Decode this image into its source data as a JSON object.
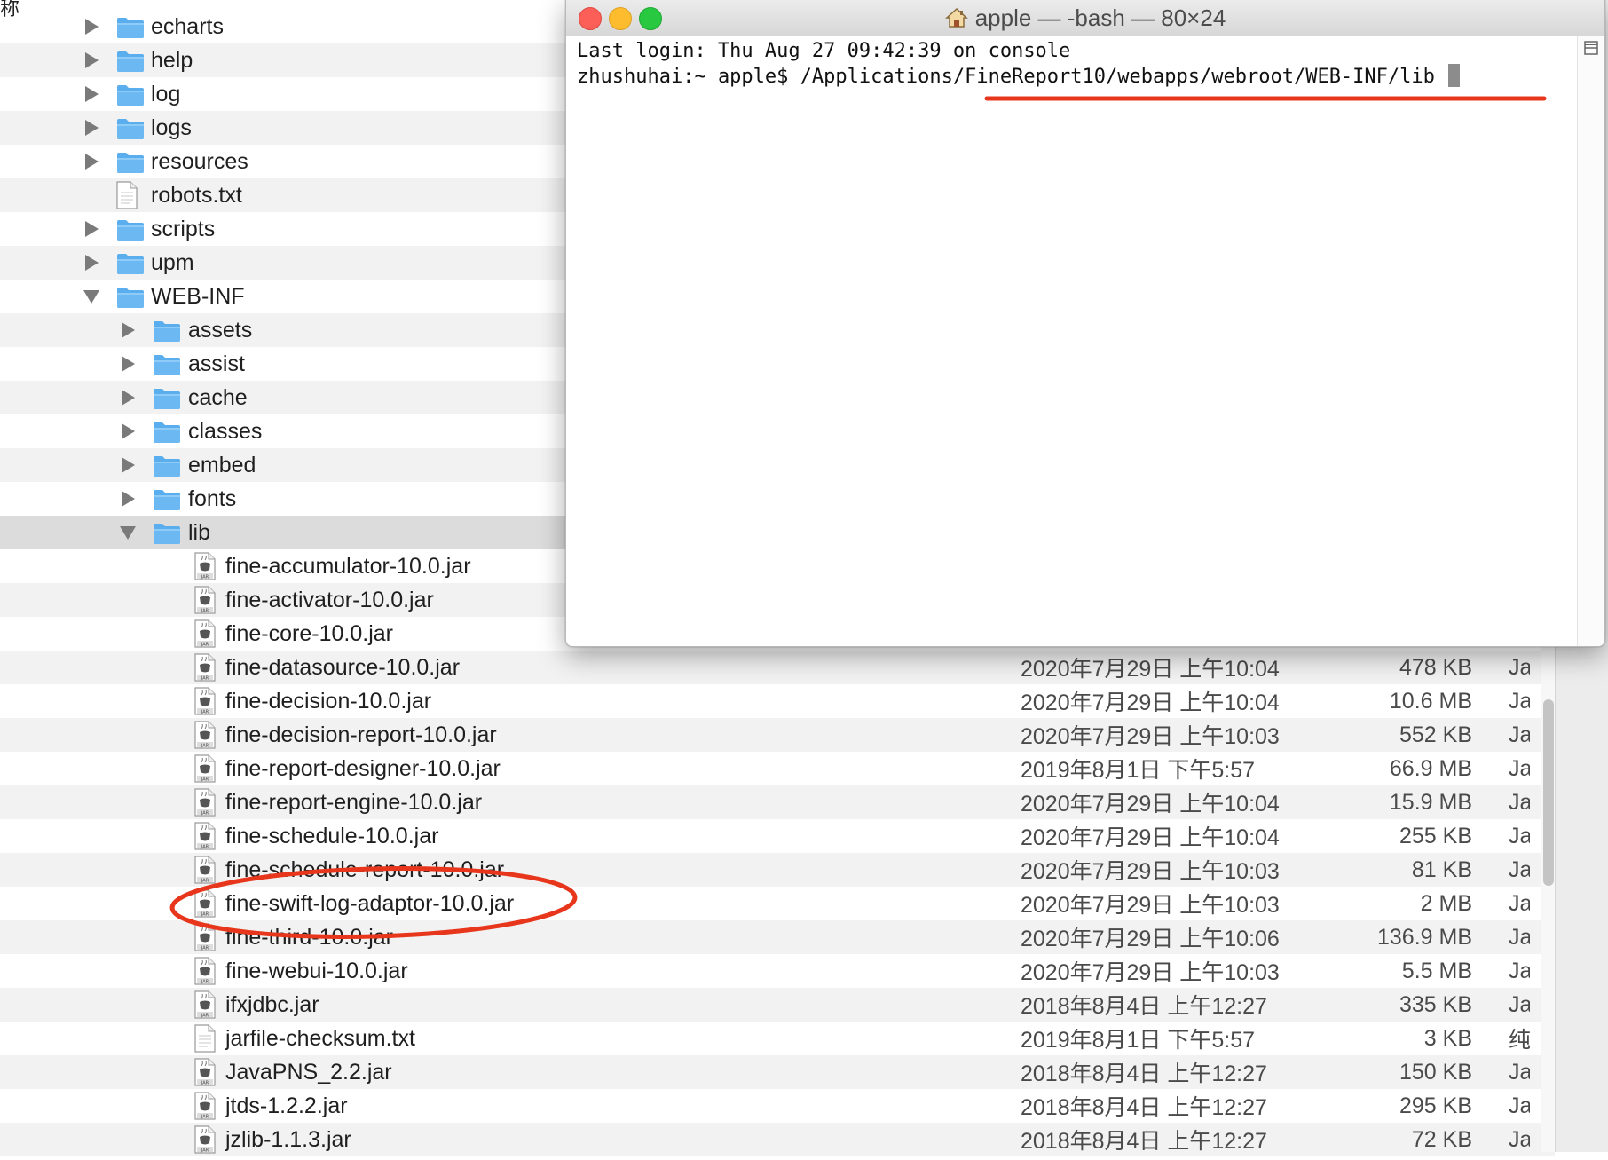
{
  "finder": {
    "top_label": "称",
    "rows": [
      {
        "name": "echarts",
        "type": "folder",
        "depth": 0,
        "state": "collapsed",
        "date": "",
        "size": "",
        "kind": ""
      },
      {
        "name": "help",
        "type": "folder",
        "depth": 0,
        "state": "collapsed",
        "date": "",
        "size": "",
        "kind": ""
      },
      {
        "name": "log",
        "type": "folder",
        "depth": 0,
        "state": "collapsed",
        "date": "",
        "size": "",
        "kind": ""
      },
      {
        "name": "logs",
        "type": "folder",
        "depth": 0,
        "state": "collapsed",
        "date": "",
        "size": "",
        "kind": ""
      },
      {
        "name": "resources",
        "type": "folder",
        "depth": 0,
        "state": "collapsed",
        "date": "",
        "size": "",
        "kind": ""
      },
      {
        "name": "robots.txt",
        "type": "txt",
        "depth": 0,
        "state": "none",
        "date": "",
        "size": "",
        "kind": ""
      },
      {
        "name": "scripts",
        "type": "folder",
        "depth": 0,
        "state": "collapsed",
        "date": "",
        "size": "",
        "kind": ""
      },
      {
        "name": "upm",
        "type": "folder",
        "depth": 0,
        "state": "collapsed",
        "date": "",
        "size": "",
        "kind": ""
      },
      {
        "name": "WEB-INF",
        "type": "folder",
        "depth": 0,
        "state": "expanded",
        "date": "",
        "size": "",
        "kind": ""
      },
      {
        "name": "assets",
        "type": "folder",
        "depth": 1,
        "state": "collapsed",
        "date": "",
        "size": "",
        "kind": ""
      },
      {
        "name": "assist",
        "type": "folder",
        "depth": 1,
        "state": "collapsed",
        "date": "",
        "size": "",
        "kind": ""
      },
      {
        "name": "cache",
        "type": "folder",
        "depth": 1,
        "state": "collapsed",
        "date": "",
        "size": "",
        "kind": ""
      },
      {
        "name": "classes",
        "type": "folder",
        "depth": 1,
        "state": "collapsed",
        "date": "",
        "size": "",
        "kind": ""
      },
      {
        "name": "embed",
        "type": "folder",
        "depth": 1,
        "state": "collapsed",
        "date": "",
        "size": "",
        "kind": ""
      },
      {
        "name": "fonts",
        "type": "folder",
        "depth": 1,
        "state": "collapsed",
        "date": "",
        "size": "",
        "kind": ""
      },
      {
        "name": "lib",
        "type": "folder",
        "depth": 1,
        "state": "expanded",
        "selected": true,
        "date": "",
        "size": "",
        "kind": ""
      },
      {
        "name": "fine-accumulator-10.0.jar",
        "type": "jar",
        "depth": 2,
        "state": "none",
        "date": "",
        "size": "",
        "kind": ""
      },
      {
        "name": "fine-activator-10.0.jar",
        "type": "jar",
        "depth": 2,
        "state": "none",
        "date": "",
        "size": "",
        "kind": ""
      },
      {
        "name": "fine-core-10.0.jar",
        "type": "jar",
        "depth": 2,
        "state": "none",
        "date": "",
        "size": "",
        "kind": ""
      },
      {
        "name": "fine-datasource-10.0.jar",
        "type": "jar",
        "depth": 2,
        "state": "none",
        "date": "2020年7月29日 上午10:04",
        "size": "478 KB",
        "kind": "Ja"
      },
      {
        "name": "fine-decision-10.0.jar",
        "type": "jar",
        "depth": 2,
        "state": "none",
        "date": "2020年7月29日 上午10:04",
        "size": "10.6 MB",
        "kind": "Ja"
      },
      {
        "name": "fine-decision-report-10.0.jar",
        "type": "jar",
        "depth": 2,
        "state": "none",
        "date": "2020年7月29日 上午10:03",
        "size": "552 KB",
        "kind": "Ja"
      },
      {
        "name": "fine-report-designer-10.0.jar",
        "type": "jar",
        "depth": 2,
        "state": "none",
        "date": "2019年8月1日 下午5:57",
        "size": "66.9 MB",
        "kind": "Ja"
      },
      {
        "name": "fine-report-engine-10.0.jar",
        "type": "jar",
        "depth": 2,
        "state": "none",
        "date": "2020年7月29日 上午10:04",
        "size": "15.9 MB",
        "kind": "Ja"
      },
      {
        "name": "fine-schedule-10.0.jar",
        "type": "jar",
        "depth": 2,
        "state": "none",
        "date": "2020年7月29日 上午10:04",
        "size": "255 KB",
        "kind": "Ja"
      },
      {
        "name": "fine-schedule-report-10.0.jar",
        "type": "jar",
        "depth": 2,
        "state": "none",
        "date": "2020年7月29日 上午10:03",
        "size": "81 KB",
        "kind": "Ja"
      },
      {
        "name": "fine-swift-log-adaptor-10.0.jar",
        "type": "jar",
        "depth": 2,
        "state": "none",
        "date": "2020年7月29日 上午10:03",
        "size": "2 MB",
        "kind": "Ja"
      },
      {
        "name": "fine-third-10.0.jar",
        "type": "jar",
        "depth": 2,
        "state": "none",
        "date": "2020年7月29日 上午10:06",
        "size": "136.9 MB",
        "kind": "Ja"
      },
      {
        "name": "fine-webui-10.0.jar",
        "type": "jar",
        "depth": 2,
        "state": "none",
        "date": "2020年7月29日 上午10:03",
        "size": "5.5 MB",
        "kind": "Ja"
      },
      {
        "name": "ifxjdbc.jar",
        "type": "jar",
        "depth": 2,
        "state": "none",
        "date": "2018年8月4日 上午12:27",
        "size": "335 KB",
        "kind": "Ja"
      },
      {
        "name": "jarfile-checksum.txt",
        "type": "txt",
        "depth": 2,
        "state": "none",
        "date": "2019年8月1日 下午5:57",
        "size": "3 KB",
        "kind": "纯"
      },
      {
        "name": "JavaPNS_2.2.jar",
        "type": "jar",
        "depth": 2,
        "state": "none",
        "date": "2018年8月4日 上午12:27",
        "size": "150 KB",
        "kind": "Ja"
      },
      {
        "name": "jtds-1.2.2.jar",
        "type": "jar",
        "depth": 2,
        "state": "none",
        "date": "2018年8月4日 上午12:27",
        "size": "295 KB",
        "kind": "Ja"
      },
      {
        "name": "jzlib-1.1.3.jar",
        "type": "jar",
        "depth": 2,
        "state": "none",
        "date": "2018年8月4日 上午12:27",
        "size": "72 KB",
        "kind": "Ja"
      }
    ]
  },
  "terminal": {
    "title": "apple — -bash — 80×24",
    "lines": [
      "Last login: Thu Aug 27 09:42:39 on console",
      "zhushuhai:~ apple$ /Applications/FineReport10/webapps/webroot/WEB-INF/lib "
    ]
  },
  "colors": {
    "annotation": "#e8361c",
    "folder": "#6cb8f2",
    "close": "#fc5f57",
    "minimize": "#fdbc2e",
    "zoom": "#28c840"
  },
  "icons": {
    "folder": "folder-icon",
    "jar": "jar-file-icon",
    "txt": "text-file-icon",
    "home": "home-icon"
  }
}
